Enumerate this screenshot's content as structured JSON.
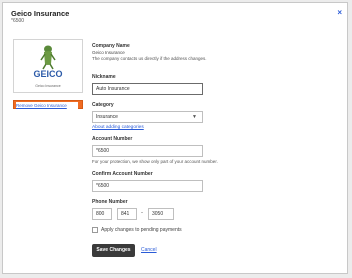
{
  "header": {
    "title": "Geico Insurance",
    "subtitle": "*6500",
    "close_glyph": "×"
  },
  "logo": {
    "wordmark": "GEICO",
    "caption": "Geico Insurance",
    "remove_label": "Remove Geico Insurance"
  },
  "company": {
    "label": "Company Name",
    "value": "Geico Insurance",
    "note": "The company contacts us directly if the address changes."
  },
  "nickname": {
    "label": "Nickname",
    "value": "Auto Insurance"
  },
  "category": {
    "label": "Category",
    "value": "Insurance",
    "arrow": "▼",
    "link": "About adding categories"
  },
  "account": {
    "label": "Account Number",
    "value": "*6500",
    "note": "For your protection, we show only part of your account number."
  },
  "confirm_account": {
    "label": "Confirm Account Number",
    "value": "*6500"
  },
  "phone": {
    "label": "Phone Number",
    "area": "800",
    "prefix": "841",
    "dash": "-",
    "line": "3050"
  },
  "pending": {
    "label": "Apply changes to pending payments",
    "checked": false
  },
  "actions": {
    "save": "Save Changes",
    "cancel": "Cancel"
  },
  "colors": {
    "accent_orange": "#f06b22",
    "link_blue": "#2a5bd7",
    "button_dark": "#3a3a3a"
  }
}
